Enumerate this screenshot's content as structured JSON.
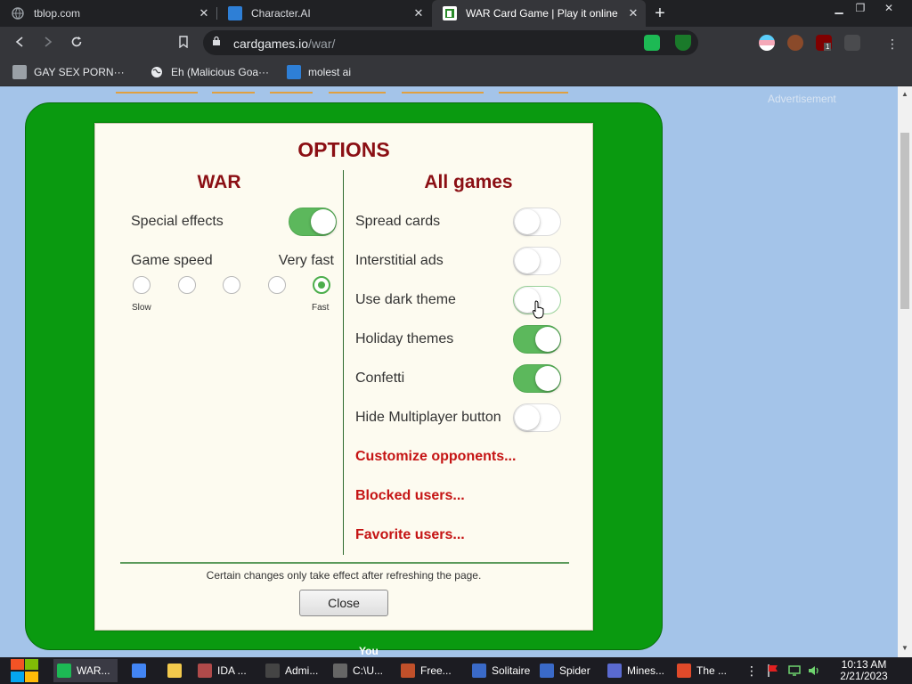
{
  "browser": {
    "tabs": [
      {
        "title": "tblop.com"
      },
      {
        "title": "Character.AI"
      },
      {
        "title": "WAR Card Game | Play it online"
      }
    ],
    "new_tab": "+",
    "close_glyph": "✕",
    "url": {
      "host": "cardgames.io",
      "path": "/war/"
    },
    "bookmarks": [
      {
        "label": "GAY SEX PORN···"
      },
      {
        "label": "Eh (Malicious Goa···"
      },
      {
        "label": "molest ai"
      }
    ],
    "extension_badge": "1"
  },
  "page": {
    "advertisement": "Advertisement",
    "player_label": "You"
  },
  "dialog": {
    "title": "OPTIONS",
    "war": {
      "heading": "WAR",
      "special_effects": {
        "label": "Special effects",
        "on": true
      },
      "game_speed": {
        "label": "Game speed",
        "value_label": "Very fast",
        "levels": 5,
        "selected_index": 4,
        "min_label": "Slow",
        "max_label": "Fast"
      }
    },
    "all_games": {
      "heading": "All games",
      "toggles": [
        {
          "label": "Spread cards",
          "on": false
        },
        {
          "label": "Interstitial ads",
          "on": false
        },
        {
          "label": "Use dark theme",
          "on": false
        },
        {
          "label": "Holiday themes",
          "on": true
        },
        {
          "label": "Confetti",
          "on": true
        },
        {
          "label": "Hide Multiplayer button",
          "on": false
        }
      ],
      "links": [
        {
          "label": "Customize opponents..."
        },
        {
          "label": "Blocked users..."
        },
        {
          "label": "Favorite users..."
        }
      ]
    },
    "note": "Certain changes only take effect after refreshing the page.",
    "close_label": "Close"
  },
  "taskbar": {
    "items": [
      {
        "label": "WAR...",
        "color": "#1db954",
        "active": true
      },
      {
        "label": "",
        "color": "#4285f4",
        "active": false
      },
      {
        "label": "",
        "color": "#f2c94c",
        "active": false
      },
      {
        "label": "IDA ...",
        "color": "#b04a4a",
        "active": false
      },
      {
        "label": "Admi...",
        "color": "#444444",
        "active": false
      },
      {
        "label": "C:\\U...",
        "color": "#666666",
        "active": false
      },
      {
        "label": "Free...",
        "color": "#c0502a",
        "active": false
      },
      {
        "label": "Solitaire",
        "color": "#3a6ac8",
        "active": false
      },
      {
        "label": "Spider",
        "color": "#3a6ac8",
        "active": false
      },
      {
        "label": "Mines...",
        "color": "#5a6ad0",
        "active": false
      },
      {
        "label": "The ...",
        "color": "#e04a2a",
        "active": false
      }
    ],
    "time": "10:13 AM",
    "date": "2/21/2023"
  },
  "colors": {
    "felt": "#0a9a10",
    "page_bg": "#a4c4e9",
    "heading": "#8b0f14",
    "link": "#c51414",
    "toggle_on": "#5cb85c"
  }
}
